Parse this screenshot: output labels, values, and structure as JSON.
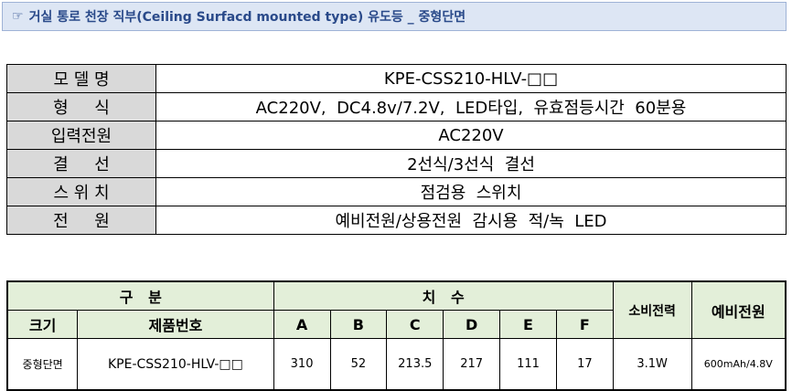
{
  "header": {
    "icon": "pointing-hand-icon",
    "hand_glyph": "☞",
    "title": "거실 통로 천장 직부(Ceiling Surfacd mounted type) 유도등 _ 중형단면"
  },
  "spec_table": {
    "rows": [
      {
        "label": "모 델 명",
        "value": "KPE-CSS210-HLV-□□"
      },
      {
        "label": "형     식",
        "value": "AC220V,  DC4.8v/7.2V,  LED타입,  유효점등시간  60분용"
      },
      {
        "label": "입력전원",
        "value": "AC220V"
      },
      {
        "label": "결     선",
        "value": "2선식/3선식  결선"
      },
      {
        "label": "스 위 치",
        "value": "점검용  스위치"
      },
      {
        "label": "전     원",
        "value": "예비전원/상용전원  감시용  적/녹  LED"
      }
    ]
  },
  "dim_table": {
    "group_header_1": "구   분",
    "group_header_2": "치   수",
    "power_header": "소비전력",
    "battery_header": "예비전원",
    "sub_headers": [
      "크기",
      "제품번호",
      "A",
      "B",
      "C",
      "D",
      "E",
      "F"
    ],
    "row": {
      "size": "중형단면",
      "model": "KPE-CSS210-HLV-□□",
      "dims": [
        "310",
        "52",
        "213.5",
        "217",
        "111",
        "17"
      ],
      "power": "3.1W",
      "battery": "600mAh/4.8V"
    }
  }
}
